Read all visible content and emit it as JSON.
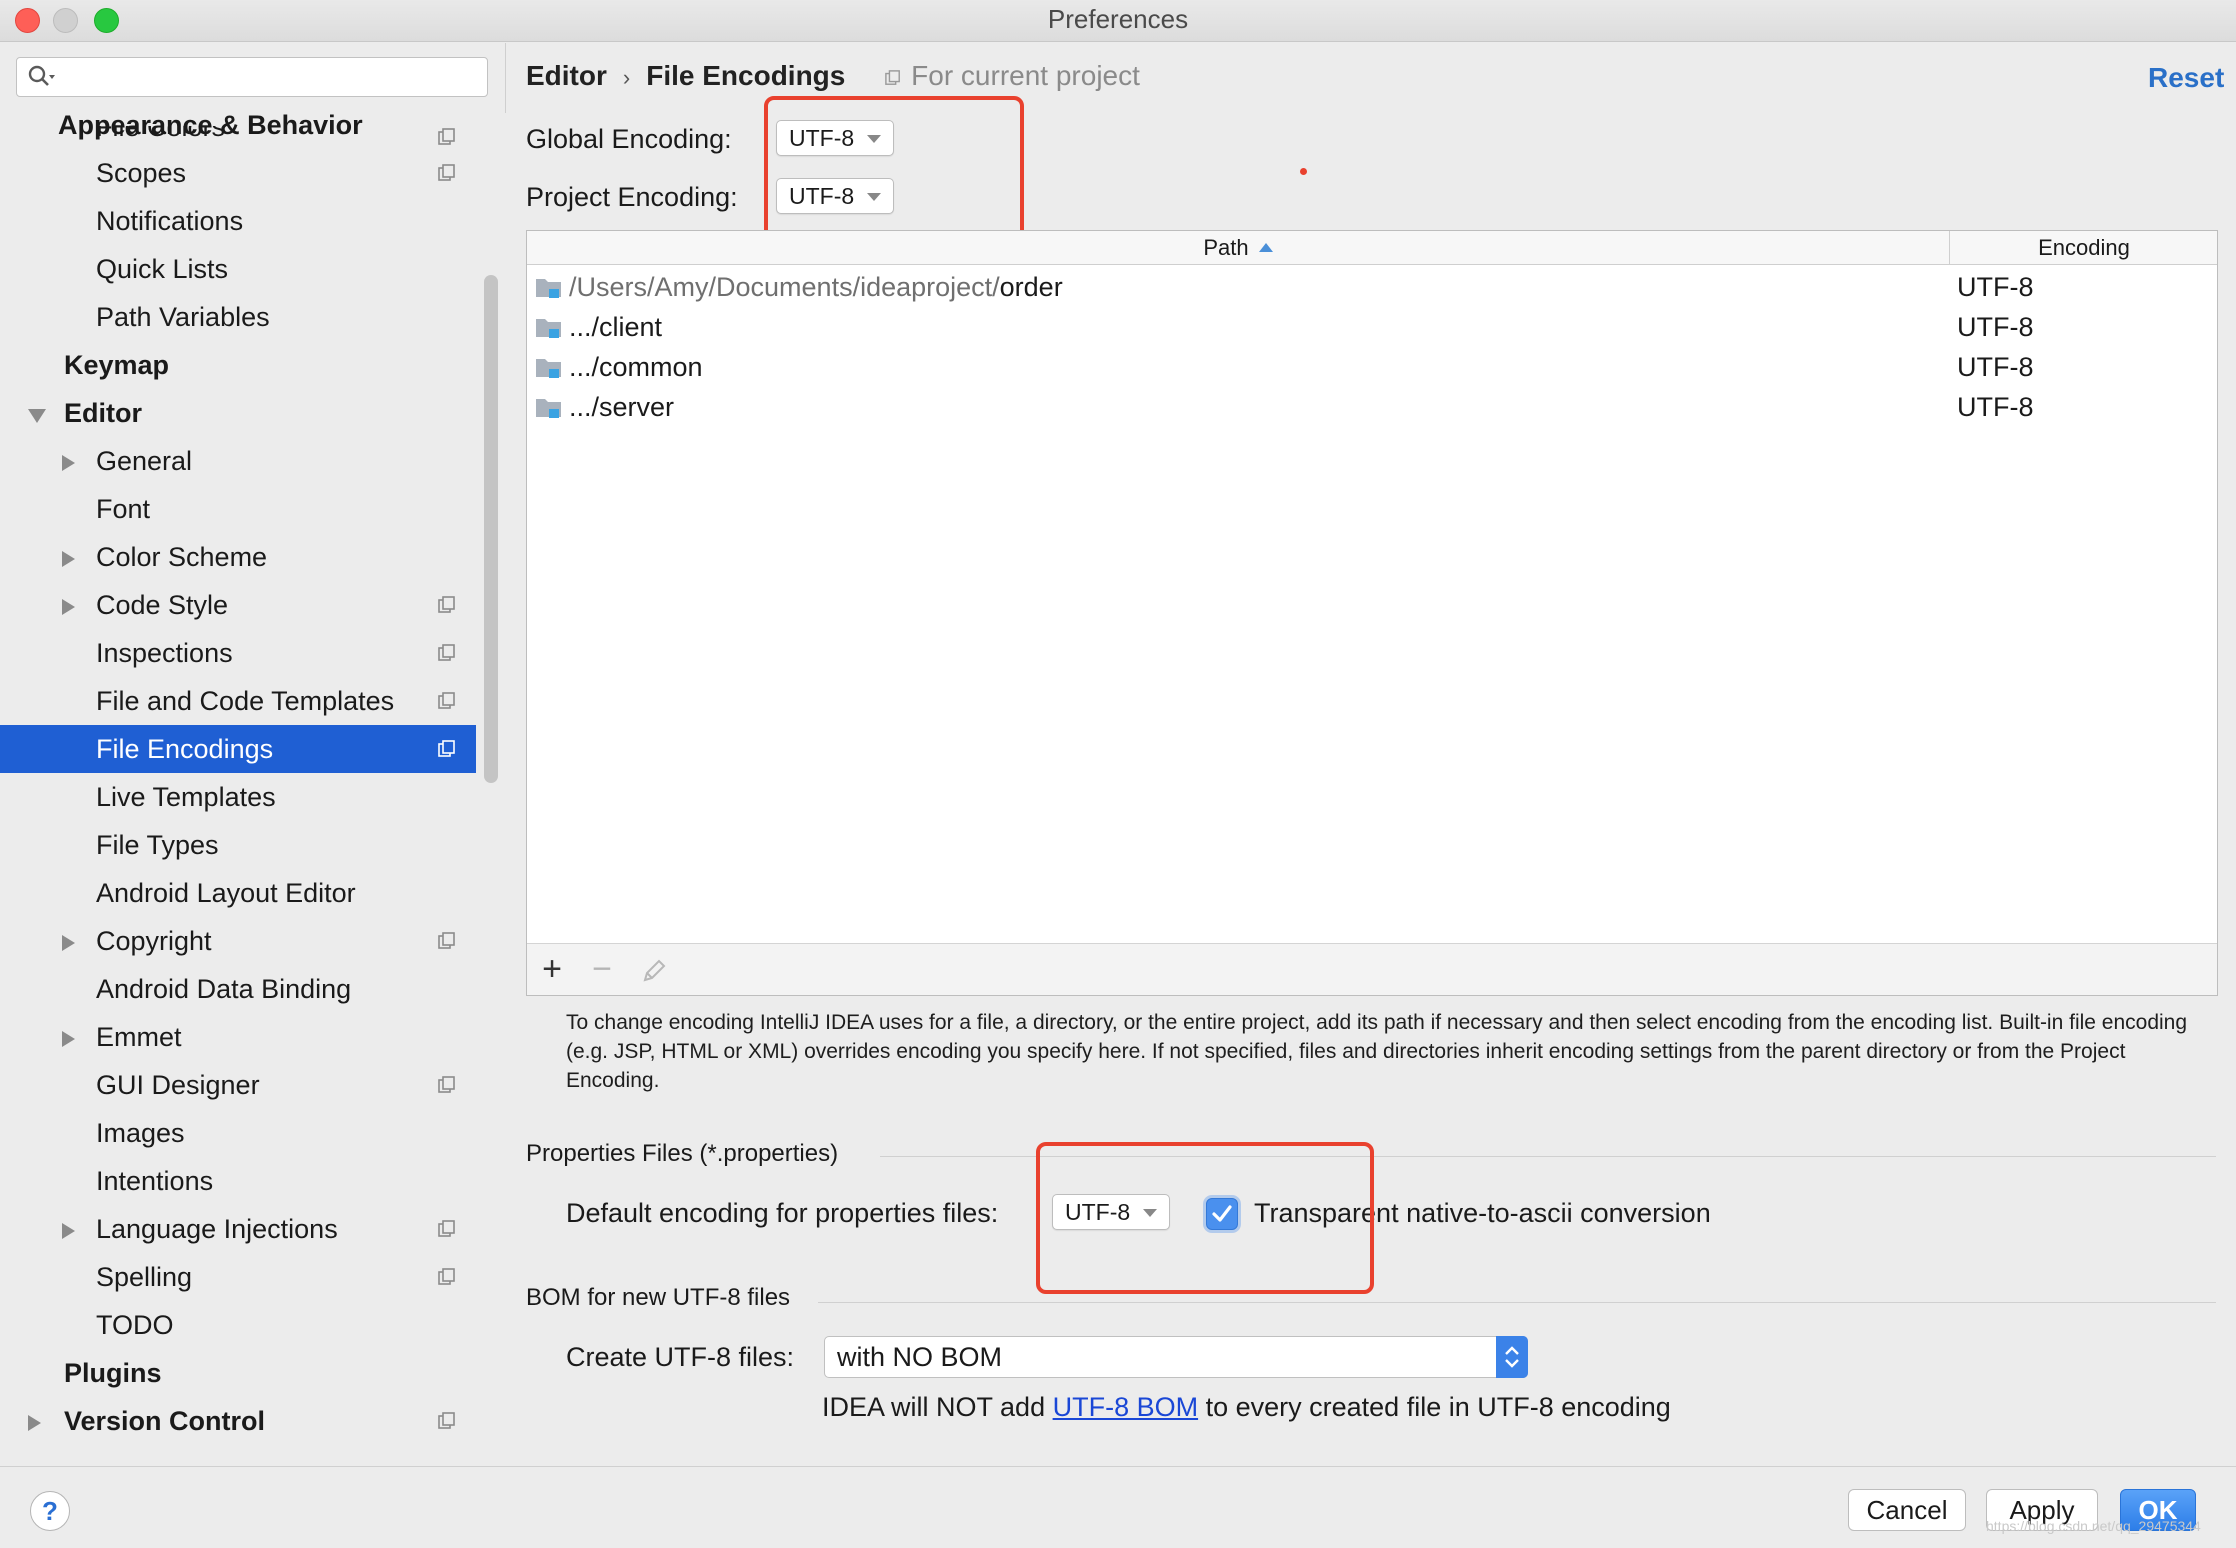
{
  "window": {
    "title": "Preferences"
  },
  "sidebar": {
    "search_placeholder": "",
    "items": [
      {
        "label": "Appearance & Behavior"
      },
      {
        "label": "File Colors"
      },
      {
        "label": "Scopes"
      },
      {
        "label": "Notifications"
      },
      {
        "label": "Quick Lists"
      },
      {
        "label": "Path Variables"
      },
      {
        "label": "Keymap"
      },
      {
        "label": "Editor"
      },
      {
        "label": "General"
      },
      {
        "label": "Font"
      },
      {
        "label": "Color Scheme"
      },
      {
        "label": "Code Style"
      },
      {
        "label": "Inspections"
      },
      {
        "label": "File and Code Templates"
      },
      {
        "label": "File Encodings"
      },
      {
        "label": "Live Templates"
      },
      {
        "label": "File Types"
      },
      {
        "label": "Android Layout Editor"
      },
      {
        "label": "Copyright"
      },
      {
        "label": "Android Data Binding"
      },
      {
        "label": "Emmet"
      },
      {
        "label": "GUI Designer"
      },
      {
        "label": "Images"
      },
      {
        "label": "Intentions"
      },
      {
        "label": "Language Injections"
      },
      {
        "label": "Spelling"
      },
      {
        "label": "TODO"
      },
      {
        "label": "Plugins"
      },
      {
        "label": "Version Control"
      }
    ],
    "selected": "File Encodings"
  },
  "header": {
    "crumb_parent": "Editor",
    "crumb_sep": "›",
    "crumb_current": "File Encodings",
    "scope_note": "For current project",
    "reset_label": "Reset"
  },
  "global_encoding": {
    "label": "Global Encoding:",
    "value": "UTF-8"
  },
  "project_encoding": {
    "label": "Project Encoding:",
    "value": "UTF-8"
  },
  "table": {
    "columns": [
      "Path",
      "Encoding"
    ],
    "rows": [
      {
        "path_prefix": "/Users/Amy/Documents/ideaproject/",
        "path_main": "order",
        "encoding": "UTF-8"
      },
      {
        "path_prefix": "",
        "path_main": ".../client",
        "encoding": "UTF-8"
      },
      {
        "path_prefix": "",
        "path_main": ".../common",
        "encoding": "UTF-8"
      },
      {
        "path_prefix": "",
        "path_main": ".../server",
        "encoding": "UTF-8"
      }
    ],
    "toolbar": {
      "add": "+",
      "remove": "−"
    }
  },
  "help_text": "To change encoding IntelliJ IDEA uses for a file, a directory, or the entire project, add its path if necessary and then select encoding from the encoding list. Built-in file encoding (e.g. JSP, HTML or XML) overrides encoding you specify here. If not specified, files and directories inherit encoding settings from the parent directory or from the Project Encoding.",
  "properties": {
    "section_title": "Properties Files (*.properties)",
    "default_label": "Default encoding for properties files:",
    "default_value": "UTF-8",
    "transparent_label": "Transparent native-to-ascii conversion",
    "transparent_checked": true
  },
  "bom": {
    "section_title": "BOM for new UTF-8 files",
    "create_label": "Create UTF-8 files:",
    "create_value": "with NO BOM",
    "note_prefix": "IDEA will NOT add ",
    "note_link": "UTF-8 BOM",
    "note_suffix": " to every created file in UTF-8 encoding"
  },
  "buttons": {
    "help": "?",
    "cancel": "Cancel",
    "apply": "Apply",
    "ok": "OK"
  },
  "watermark": "https://blog.csdn.net/qq_29475344",
  "colors": {
    "accent": "#1f5fd3",
    "link": "#2a70c8",
    "highlight_box": "#e9412e",
    "ok_button": "#2d7ee8"
  }
}
